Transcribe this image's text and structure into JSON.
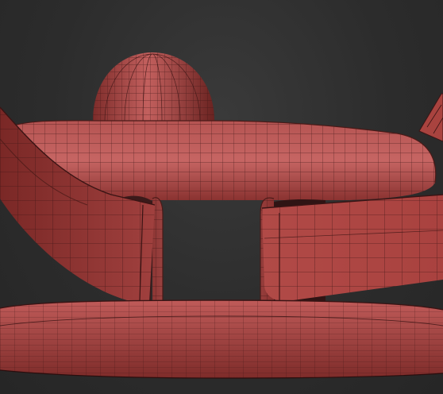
{
  "viewport": {
    "background_color": "#2b2b2b"
  },
  "model": {
    "surface_color": "#b8504f",
    "surface_dark": "#6e2523",
    "wire_color": "#3a1414",
    "parts": [
      "dome",
      "torus-hub",
      "central-post",
      "left-arm",
      "right-arm",
      "base-disc",
      "far-right-fin"
    ]
  }
}
